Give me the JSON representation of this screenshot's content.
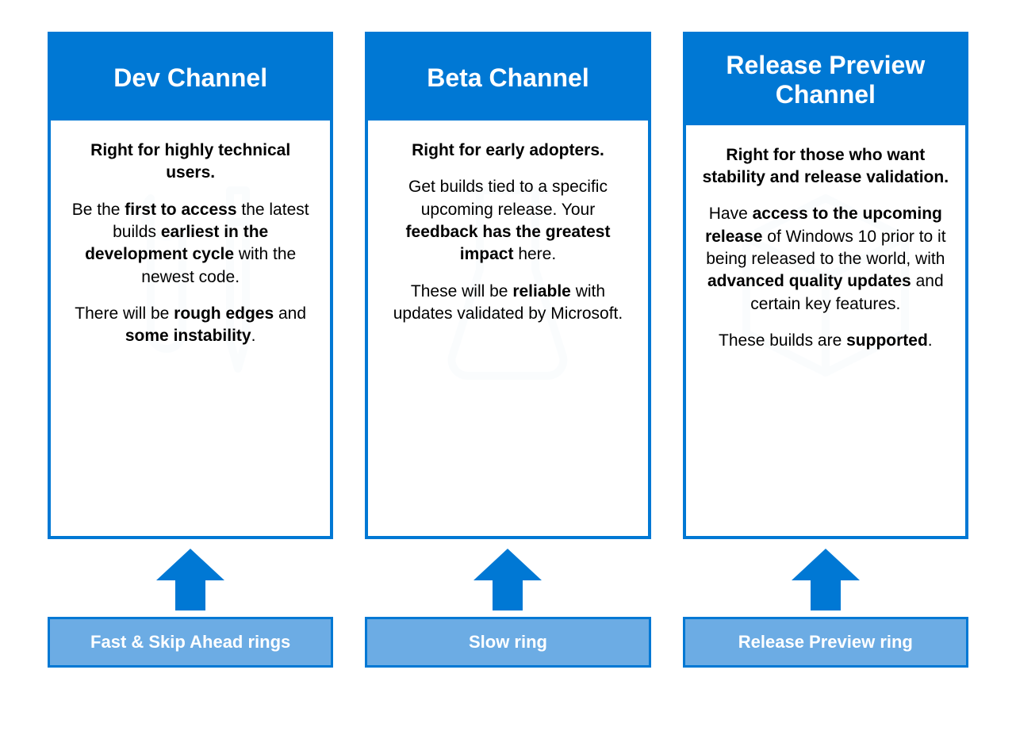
{
  "colors": {
    "primary": "#0078D4",
    "light": "#6CACE4",
    "iconBg": "#d8e9f6"
  },
  "columns": [
    {
      "title": "Dev Channel",
      "icon": "wrench-pencil-icon",
      "p1_html": "Right for highly technical users.",
      "p2_html": "Be the <b>first to access</b> the latest builds <b>earliest in the development cycle</b> with the newest code.",
      "p3_html": "There will be <b>rough edges</b> and <b>some instability</b>.",
      "ring": "Fast & Skip Ahead rings"
    },
    {
      "title": "Beta Channel",
      "icon": "beaker-icon",
      "p1_html": "Right for early adopters.",
      "p2_html": "Get builds tied to a specific upcoming release. Your <b>feedback has the greatest impact</b> here.",
      "p3_html": "These will be <b>reliable</b> with updates validated by Microsoft.",
      "ring": "Slow ring"
    },
    {
      "title": "Release Preview Channel",
      "icon": "box-icon",
      "p1_html": "Right for those who want stability and release validation.",
      "p2_html": "Have <b>access to the upcoming release</b> of Windows 10 prior to it being released to the world, with <b>advanced quality updates</b> and certain key features.",
      "p3_html": "These builds are <b>supported</b>.",
      "ring": "Release Preview ring"
    }
  ]
}
